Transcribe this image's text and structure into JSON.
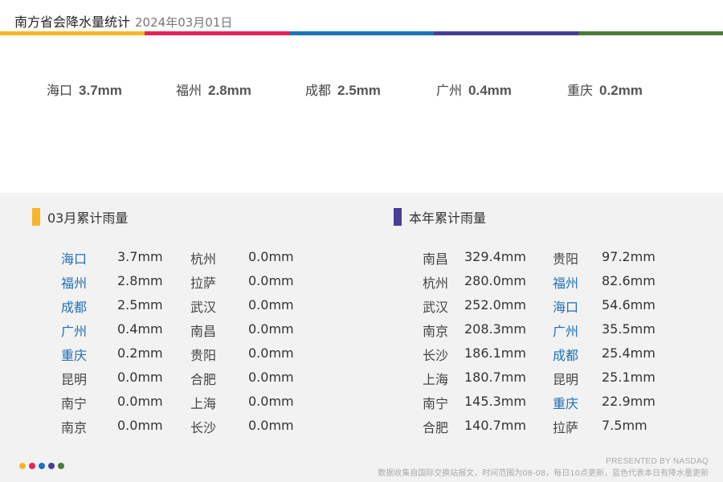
{
  "header": {
    "title": "南方省会降水量统计",
    "date": "2024年03月01日",
    "bar_colors": [
      "#f7b52c",
      "#e4245e",
      "#1b75bb",
      "#473f95",
      "#4a7b3a"
    ]
  },
  "today": [
    {
      "city": "海口",
      "value": "3.7mm"
    },
    {
      "city": "福州",
      "value": "2.8mm"
    },
    {
      "city": "成都",
      "value": "2.5mm"
    },
    {
      "city": "广州",
      "value": "0.4mm"
    },
    {
      "city": "重庆",
      "value": "0.2mm"
    }
  ],
  "monthly": {
    "title": "03月累计雨量",
    "color": "#f7b52c",
    "left": [
      {
        "city": "海口",
        "value": "3.7mm",
        "highlight": true
      },
      {
        "city": "福州",
        "value": "2.8mm",
        "highlight": true
      },
      {
        "city": "成都",
        "value": "2.5mm",
        "highlight": true
      },
      {
        "city": "广州",
        "value": "0.4mm",
        "highlight": true
      },
      {
        "city": "重庆",
        "value": "0.2mm",
        "highlight": true
      },
      {
        "city": "昆明",
        "value": "0.0mm",
        "highlight": false
      },
      {
        "city": "南宁",
        "value": "0.0mm",
        "highlight": false
      },
      {
        "city": "南京",
        "value": "0.0mm",
        "highlight": false
      }
    ],
    "right": [
      {
        "city": "杭州",
        "value": "0.0mm",
        "highlight": false
      },
      {
        "city": "拉萨",
        "value": "0.0mm",
        "highlight": false
      },
      {
        "city": "武汉",
        "value": "0.0mm",
        "highlight": false
      },
      {
        "city": "南昌",
        "value": "0.0mm",
        "highlight": false
      },
      {
        "city": "贵阳",
        "value": "0.0mm",
        "highlight": false
      },
      {
        "city": "合肥",
        "value": "0.0mm",
        "highlight": false
      },
      {
        "city": "上海",
        "value": "0.0mm",
        "highlight": false
      },
      {
        "city": "长沙",
        "value": "0.0mm",
        "highlight": false
      }
    ]
  },
  "yearly": {
    "title": "本年累计雨量",
    "color": "#473f95",
    "left": [
      {
        "city": "南昌",
        "value": "329.4mm",
        "highlight": false
      },
      {
        "city": "杭州",
        "value": "280.0mm",
        "highlight": false
      },
      {
        "city": "武汉",
        "value": "252.0mm",
        "highlight": false
      },
      {
        "city": "南京",
        "value": "208.3mm",
        "highlight": false
      },
      {
        "city": "长沙",
        "value": "186.1mm",
        "highlight": false
      },
      {
        "city": "上海",
        "value": "180.7mm",
        "highlight": false
      },
      {
        "city": "南宁",
        "value": "145.3mm",
        "highlight": false
      },
      {
        "city": "合肥",
        "value": "140.7mm",
        "highlight": false
      }
    ],
    "right": [
      {
        "city": "贵阳",
        "value": "97.2mm",
        "highlight": false
      },
      {
        "city": "福州",
        "value": "82.6mm",
        "highlight": true
      },
      {
        "city": "海口",
        "value": "54.6mm",
        "highlight": true
      },
      {
        "city": "广州",
        "value": "35.5mm",
        "highlight": true
      },
      {
        "city": "成都",
        "value": "25.4mm",
        "highlight": true
      },
      {
        "city": "昆明",
        "value": "25.1mm",
        "highlight": false
      },
      {
        "city": "重庆",
        "value": "22.9mm",
        "highlight": true
      },
      {
        "city": "拉萨",
        "value": "7.5mm",
        "highlight": false
      }
    ]
  },
  "footer": {
    "presented": "PRESENTED BY NASDAQ",
    "note": "数据收集自国际交换站报文，时间范围为08-08，每日10点更新，蓝色代表本日有降水量更新",
    "dot_colors": [
      "#f7b52c",
      "#e4245e",
      "#1b75bb",
      "#473f95",
      "#4a7b3a"
    ]
  }
}
